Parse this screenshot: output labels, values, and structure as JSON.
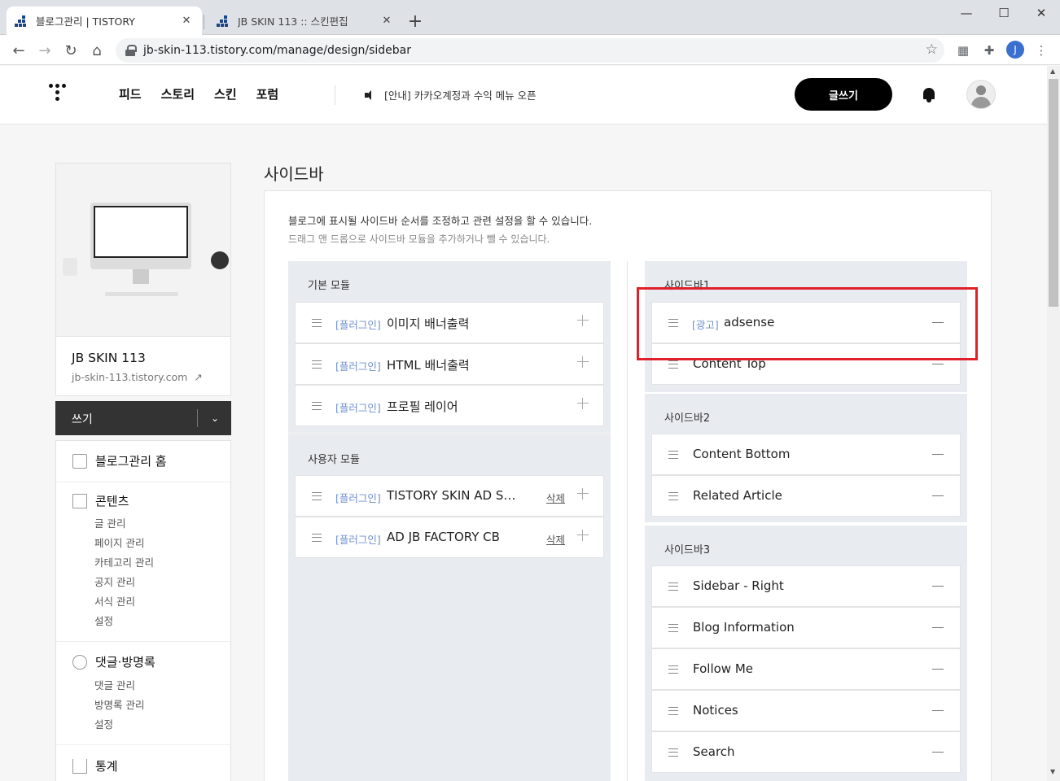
{
  "browser": {
    "tabs": [
      {
        "title": "블로그관리 | TISTORY",
        "active": true
      },
      {
        "title": "JB SKIN 113 :: 스킨편집",
        "active": false
      }
    ],
    "url": "jb-skin-113.tistory.com/manage/design/sidebar",
    "profile_initial": "J"
  },
  "header": {
    "nav": [
      "피드",
      "스토리",
      "스킨",
      "포럼"
    ],
    "notice": "[안내] 카카오계정과 수익 메뉴 오픈",
    "write_button": "글쓰기"
  },
  "blog": {
    "name": "JB SKIN 113",
    "url": "jb-skin-113.tistory.com",
    "write_bar": "쓰기"
  },
  "menu": {
    "home": "블로그관리 홈",
    "content": {
      "title": "콘텐츠",
      "items": [
        "글 관리",
        "페이지 관리",
        "카테고리 관리",
        "공지 관리",
        "서식 관리",
        "설정"
      ]
    },
    "comments": {
      "title": "댓글·방명록",
      "items": [
        "댓글 관리",
        "방명록 관리",
        "설정"
      ]
    },
    "stats": "통계"
  },
  "page": {
    "title": "사이드바",
    "desc1": "블로그에 표시될 사이드바 순서를 조정하고 관련 설정을 할 수 있습니다.",
    "desc2": "드래그 앤 드롭으로 사이드바 모듈을 추가하거나 뺄 수 있습니다."
  },
  "basic_modules": {
    "title": "기본 모듈",
    "items": [
      {
        "tag": "[플러그인]",
        "name": "이미지 배너출력"
      },
      {
        "tag": "[플러그인]",
        "name": "HTML 배너출력"
      },
      {
        "tag": "[플러그인]",
        "name": "프로필 레이어"
      }
    ]
  },
  "user_modules": {
    "title": "사용자 모듈",
    "delete_label": "삭제",
    "items": [
      {
        "tag": "[플러그인]",
        "name": "TISTORY SKIN AD S…"
      },
      {
        "tag": "[플러그인]",
        "name": "AD JB FACTORY CB"
      }
    ]
  },
  "sidebar1": {
    "title": "사이드바1",
    "items": [
      {
        "tag": "[광고]",
        "name": "adsense"
      },
      {
        "tag": "",
        "name": "Content Top"
      }
    ]
  },
  "sidebar2": {
    "title": "사이드바2",
    "items": [
      {
        "tag": "",
        "name": "Content Bottom"
      },
      {
        "tag": "",
        "name": "Related Article"
      }
    ]
  },
  "sidebar3": {
    "title": "사이드바3",
    "items": [
      {
        "tag": "",
        "name": "Sidebar - Right"
      },
      {
        "tag": "",
        "name": "Blog Information"
      },
      {
        "tag": "",
        "name": "Follow Me"
      },
      {
        "tag": "",
        "name": "Notices"
      },
      {
        "tag": "",
        "name": "Search"
      }
    ]
  },
  "colors": {
    "highlight": "#e0202a",
    "tag": "#6f8fcf"
  }
}
